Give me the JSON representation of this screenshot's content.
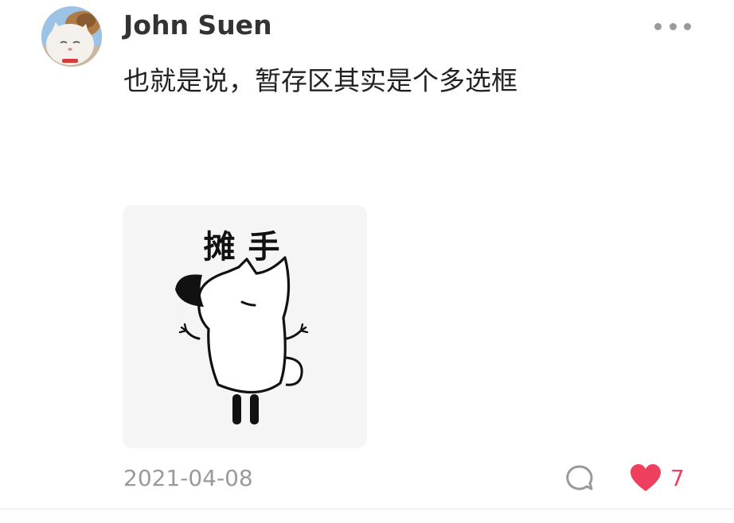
{
  "comment": {
    "author": "John Suen",
    "text": "也就是说，暂存区其实是个多选框",
    "sticker_caption": "摊手",
    "date": "2021-04-08",
    "like_count": "7",
    "liked": true
  },
  "colors": {
    "like_accent": "#ee3f5e",
    "meta_gray": "#9a9a9a",
    "author_text": "#333333"
  },
  "icons": {
    "more": "more-dots-icon",
    "reply": "comment-bubble-icon",
    "like": "heart-icon"
  }
}
